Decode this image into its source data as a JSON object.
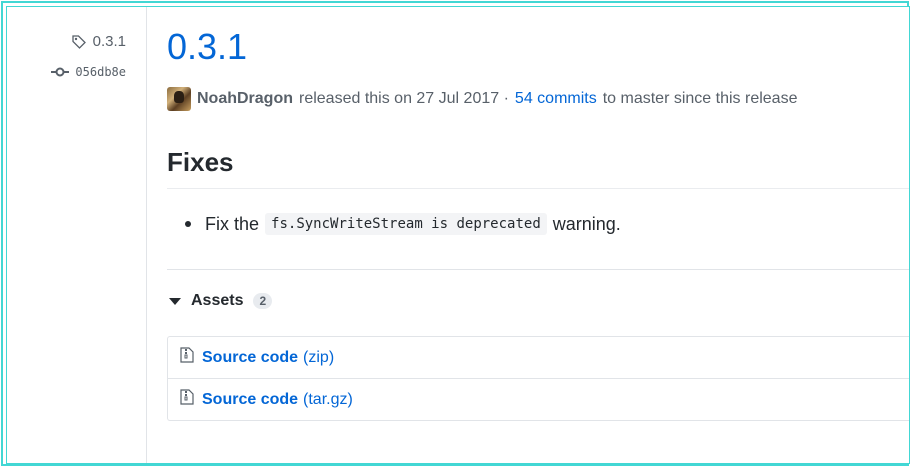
{
  "tag": {
    "name": "0.3.1"
  },
  "commit": {
    "sha": "056db8e"
  },
  "release": {
    "title": "0.3.1",
    "author": "NoahDragon",
    "released_text": "released this on 27 Jul 2017 ·",
    "commits_link": "54 commits",
    "since_text": "to master since this release"
  },
  "notes": {
    "heading": "Fixes",
    "items": [
      {
        "prefix": "Fix the",
        "code": "fs.SyncWriteStream is deprecated",
        "suffix": "warning."
      }
    ]
  },
  "assets": {
    "heading": "Assets",
    "count": "2",
    "items": [
      {
        "label": "Source code",
        "format": "(zip)"
      },
      {
        "label": "Source code",
        "format": "(tar.gz)"
      }
    ]
  },
  "colors": {
    "link": "#0366d6",
    "frame": "#42d7d4",
    "text": "#24292e",
    "muted": "#586069"
  },
  "icons": {
    "tag": "tag-icon",
    "commit": "git-commit-icon",
    "archive": "file-zip-icon",
    "caret": "triangle-down-icon"
  }
}
